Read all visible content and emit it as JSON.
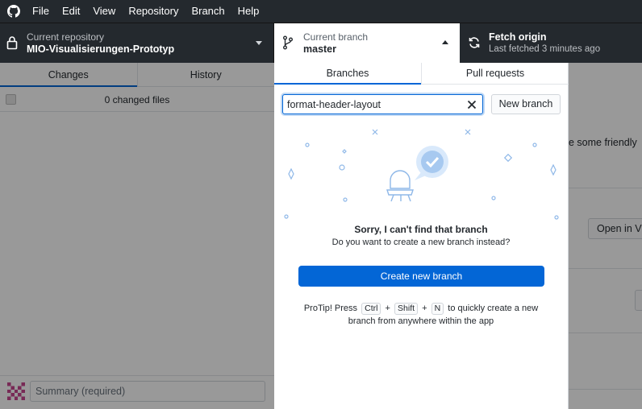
{
  "menu": [
    "File",
    "Edit",
    "View",
    "Repository",
    "Branch",
    "Help"
  ],
  "toolbar": {
    "repo_label": "Current repository",
    "repo_name": "MIO-Visualisierungen-Prototyp",
    "branch_label": "Current branch",
    "branch_name": "master",
    "fetch_title": "Fetch origin",
    "fetch_sub": "Last fetched 3 minutes ago"
  },
  "left": {
    "tab_changes": "Changes",
    "tab_history": "History",
    "changed_files": "0 changed files",
    "summary_placeholder": "Summary (required)"
  },
  "right_bg": {
    "friendly_text": "e some friendly",
    "open_in_button": "Open in Vi"
  },
  "popover": {
    "tab_branches": "Branches",
    "tab_pull_requests": "Pull requests",
    "filter_value": "format-header-layout",
    "new_branch_button": "New branch",
    "empty_title": "Sorry, I can't find that branch",
    "empty_subtitle": "Do you want to create a new branch instead?",
    "create_button": "Create new branch",
    "protip_prefix": "ProTip! Press",
    "key_ctrl": "Ctrl",
    "key_shift": "Shift",
    "key_n": "N",
    "plus": "+",
    "protip_suffix": "to quickly create a new branch from anywhere within the app"
  },
  "colors": {
    "accent": "#0366d6",
    "toolbar_bg": "#24292e",
    "overlay": "rgba(0,0,0,0.4)"
  }
}
